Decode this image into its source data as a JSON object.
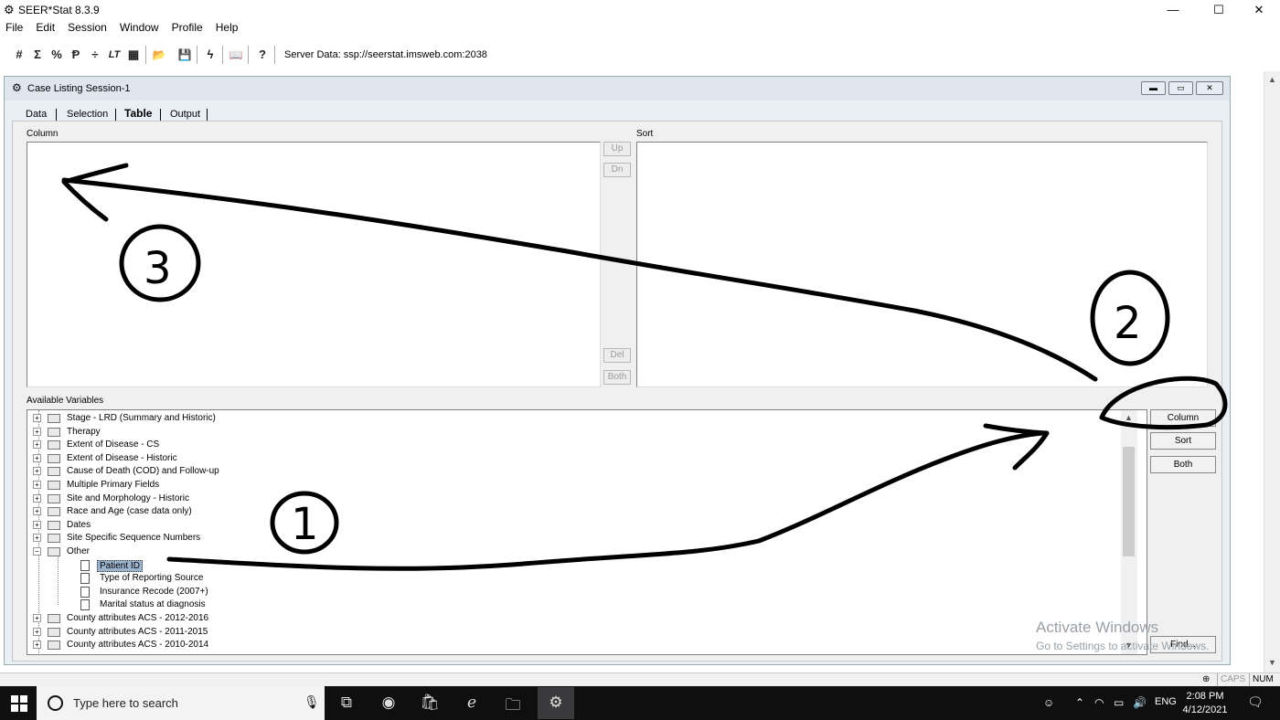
{
  "app": {
    "title": "SEER*Stat 8.3.9",
    "controls": {
      "minimize": "—",
      "maximize": "☐",
      "close": "✕"
    }
  },
  "menu": [
    "File",
    "Edit",
    "Session",
    "Window",
    "Profile",
    "Help"
  ],
  "toolbar": {
    "icons": [
      "hash-icon",
      "sigma-icon",
      "percent-icon",
      "p-icon",
      "divide-icon",
      "lt-icon",
      "grid-icon",
      "open-folder-icon",
      "save-icon",
      "lightning-icon",
      "book-icon",
      "help-icon"
    ],
    "glyphs": [
      "#",
      "Σ",
      "%",
      "Ᵽ",
      "÷",
      "LT",
      "▦",
      "📂",
      "💾",
      "ϟ",
      "📖",
      "?"
    ],
    "server_data": "Server Data: ssp://seerstat.imsweb.com:2038"
  },
  "session": {
    "title": "Case Listing Session-1",
    "tabs": [
      "Data",
      "Selection",
      "Table",
      "Output"
    ],
    "active_tab": "Table",
    "column_label": "Column",
    "sort_label": "Sort",
    "buttons": {
      "up": "Up",
      "dn": "Dn",
      "del": "Del",
      "both": "Both"
    },
    "available_label": "Available Variables",
    "variables": [
      {
        "label": "Stage - LRD (Summary and Historic)",
        "kind": "folder"
      },
      {
        "label": "Therapy",
        "kind": "folder"
      },
      {
        "label": "Extent of Disease - CS",
        "kind": "folder"
      },
      {
        "label": "Extent of Disease - Historic",
        "kind": "folder"
      },
      {
        "label": "Cause of Death (COD) and Follow-up",
        "kind": "folder"
      },
      {
        "label": "Multiple Primary Fields",
        "kind": "folder"
      },
      {
        "label": "Site and Morphology - Historic",
        "kind": "folder"
      },
      {
        "label": "Race and Age (case data only)",
        "kind": "folder"
      },
      {
        "label": "Dates",
        "kind": "folder"
      },
      {
        "label": "Site Specific Sequence Numbers",
        "kind": "folder"
      },
      {
        "label": "Other",
        "kind": "folder-open"
      },
      {
        "label": "Patient ID",
        "kind": "item",
        "selected": true
      },
      {
        "label": "Type of Reporting Source",
        "kind": "item"
      },
      {
        "label": "Insurance Recode (2007+)",
        "kind": "item"
      },
      {
        "label": "Marital status at diagnosis",
        "kind": "item"
      },
      {
        "label": "County attributes ACS - 2012-2016",
        "kind": "folder"
      },
      {
        "label": "County attributes ACS - 2011-2015",
        "kind": "folder"
      },
      {
        "label": "County attributes ACS - 2010-2014",
        "kind": "folder"
      }
    ],
    "side_buttons": {
      "column": "Column",
      "sort": "Sort",
      "both": "Both",
      "find": "Find..."
    }
  },
  "watermark": {
    "line1": "Activate Windows",
    "line2": "Go to Settings to activate Windows."
  },
  "status": {
    "caps": "CAPS",
    "num": "NUM"
  },
  "taskbar": {
    "search_placeholder": "Type here to search",
    "language": "ENG",
    "time": "2:08 PM",
    "date": "4/12/2021"
  },
  "annotations": [
    "1",
    "2",
    "3"
  ]
}
